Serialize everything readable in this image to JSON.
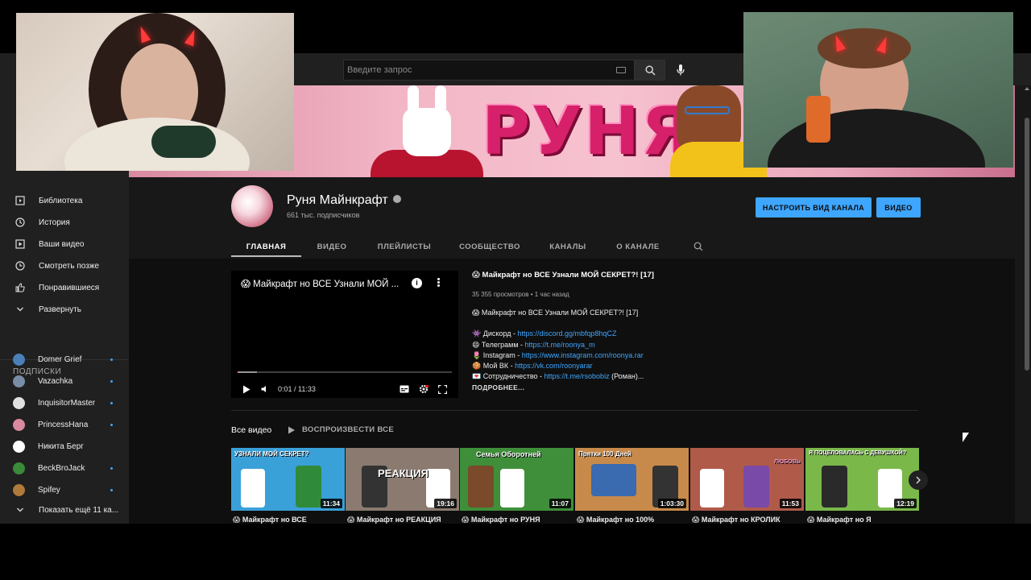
{
  "search": {
    "placeholder": "Введите запрос"
  },
  "sidebar": {
    "items": [
      {
        "label": "Библиотека",
        "icon": "library-icon"
      },
      {
        "label": "История",
        "icon": "history-icon"
      },
      {
        "label": "Ваши видео",
        "icon": "your-videos-icon"
      },
      {
        "label": "Смотреть позже",
        "icon": "watch-later-icon"
      },
      {
        "label": "Понравившиеся",
        "icon": "thumbs-up-icon"
      },
      {
        "label": "Развернуть",
        "icon": "chevron-down-icon"
      }
    ],
    "subscriptions_title": "ПОДПИСКИ",
    "subscriptions": [
      {
        "name": "Domer Grief",
        "color": "#4a7fb8"
      },
      {
        "name": "Vazachka",
        "color": "#7a8da6"
      },
      {
        "name": "InquisitorMaster",
        "color": "#e0e0e0"
      },
      {
        "name": "PrincessHana",
        "color": "#d98aa0"
      },
      {
        "name": "Никита Берг",
        "color": "#ffffff"
      },
      {
        "name": "BeckBroJack",
        "color": "#3a8a3a"
      },
      {
        "name": "Spifey",
        "color": "#b07a3a"
      }
    ],
    "show_more": "Показать ещё 11 ка..."
  },
  "banner": {
    "title": "РУНЯ"
  },
  "channel": {
    "name": "Руня Майнкрафт",
    "subscribers": "661 тыс. подписчиков",
    "customize_button": "НАСТРОИТЬ ВИД КАНАЛА",
    "video_button": "ВИДЕО"
  },
  "tabs": [
    {
      "label": "ГЛАВНАЯ",
      "active": true
    },
    {
      "label": "ВИДЕО",
      "active": false
    },
    {
      "label": "ПЛЕЙЛИСТЫ",
      "active": false
    },
    {
      "label": "СООБЩЕСТВО",
      "active": false
    },
    {
      "label": "КАНАЛЫ",
      "active": false
    },
    {
      "label": "О КАНАЛЕ",
      "active": false
    }
  ],
  "player": {
    "title": "😱 Майкрафт но ВСЕ Узнали МОЙ ...",
    "time": "0:01 / 11:33",
    "progress": 0.0015
  },
  "featured": {
    "title": "😱 Майкрафт но ВСЕ Узнали МОЙ СЕКРЕТ?! [17]",
    "meta": "35 355 просмотров • 1 час назад",
    "desc_line1": "😱 Майкрафт но ВСЕ Узнали МОЙ СЕКРЕТ?! [17]",
    "links": [
      {
        "emoji": "👾",
        "label": "Дискорд - ",
        "url": "https://discord.gg/mbfqp8hqCZ",
        "suffix": ""
      },
      {
        "emoji": "😄",
        "label": "Телеграмм - ",
        "url": "https://t.me/roonya_m",
        "suffix": ""
      },
      {
        "emoji": "🌷",
        "label": "Instagram - ",
        "url": "https://www.instagram.com/roonya.rar",
        "suffix": ""
      },
      {
        "emoji": "🍪",
        "label": "Мой ВК - ",
        "url": "https://vk.com/roonyarar",
        "suffix": ""
      },
      {
        "emoji": "💌",
        "label": "Сотрудничество - ",
        "url": "https://t.me/rsobobiz",
        "suffix": " (Роман)..."
      }
    ],
    "more": "ПОДРОБНЕЕ..."
  },
  "all_videos": {
    "title": "Все видео",
    "play_all": "ВОСПРОИЗВЕСТИ ВСЕ",
    "videos": [
      {
        "caption": "УЗНАЛИ МОЙ СЕКРЕТ?",
        "duration": "11:34",
        "title": "😱 Майкрафт но ВСЕ",
        "bg": "#3aa0d8"
      },
      {
        "caption": "РЕАКЦИЯ",
        "duration": "19:16",
        "title": "😱 Майкрафт но РЕАКЦИЯ",
        "bg": "#8a7a70"
      },
      {
        "caption": "Семья Оборотней",
        "duration": "11:07",
        "title": "😱 Майкрафт но РУНЯ",
        "bg": "#3f8f3a"
      },
      {
        "caption": "Прятки 100 Дней",
        "duration": "1:03:30",
        "title": "😱 Майкрафт но 100%",
        "bg": "#c88a4a"
      },
      {
        "caption": "ЛЮБОВЬ",
        "duration": "11:53",
        "title": "😱 Майкрафт но КРОЛИК",
        "bg": "#b05a4a"
      },
      {
        "caption": "Я ПОЦЕЛОВАЛАСЬ С ДЕВУШКОЙ?",
        "duration": "12:19",
        "title": "😱 Майкрафт но Я",
        "bg": "#7ab84a"
      }
    ]
  }
}
